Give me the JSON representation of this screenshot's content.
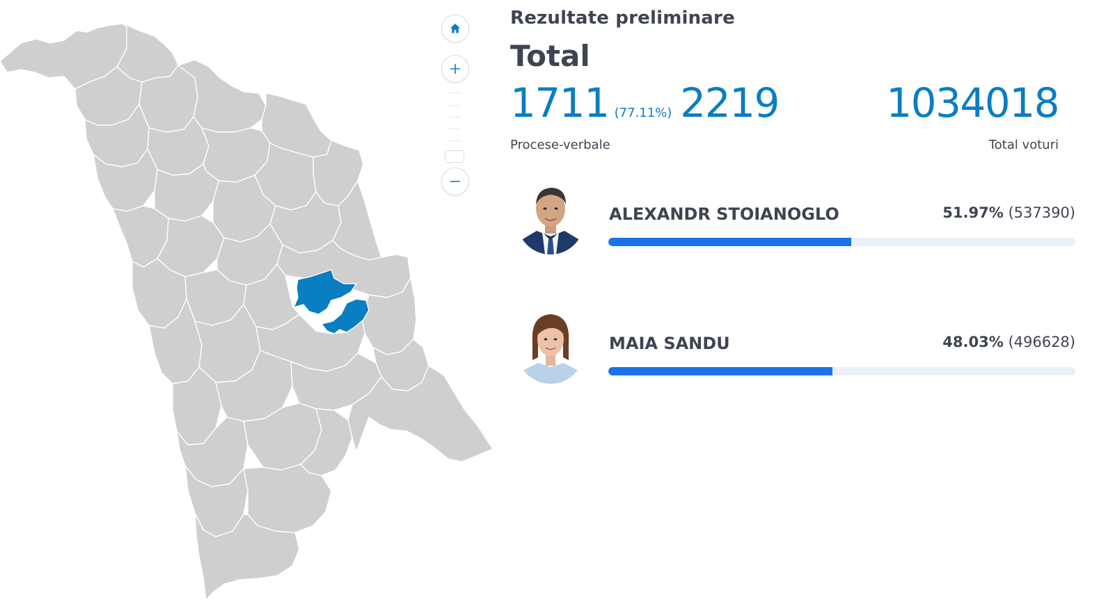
{
  "map": {
    "base_color": "#cfcfcf",
    "highlight_color": "#0a7ec2",
    "controls": {
      "home_icon": "home-icon",
      "zoom_in_icon": "plus-icon",
      "zoom_out_icon": "minus-icon"
    }
  },
  "results": {
    "subtitle": "Rezultate preliminare",
    "title": "Total",
    "protocols_counted": "1711",
    "protocols_percent": "(77.11%)",
    "protocols_total": "2219",
    "protocols_label": "Procese-verbale",
    "total_votes": "1034018",
    "total_votes_label": "Total voturi",
    "accent_color": "#0a7ec2",
    "bar_color": "#1a73e8"
  },
  "candidates": [
    {
      "name": "ALEXANDR STOIANOGLO",
      "percent": "51.97%",
      "votes": "(537390)",
      "share": 51.97
    },
    {
      "name": "MAIA SANDU",
      "percent": "48.03%",
      "votes": "(496628)",
      "share": 48.03
    }
  ]
}
